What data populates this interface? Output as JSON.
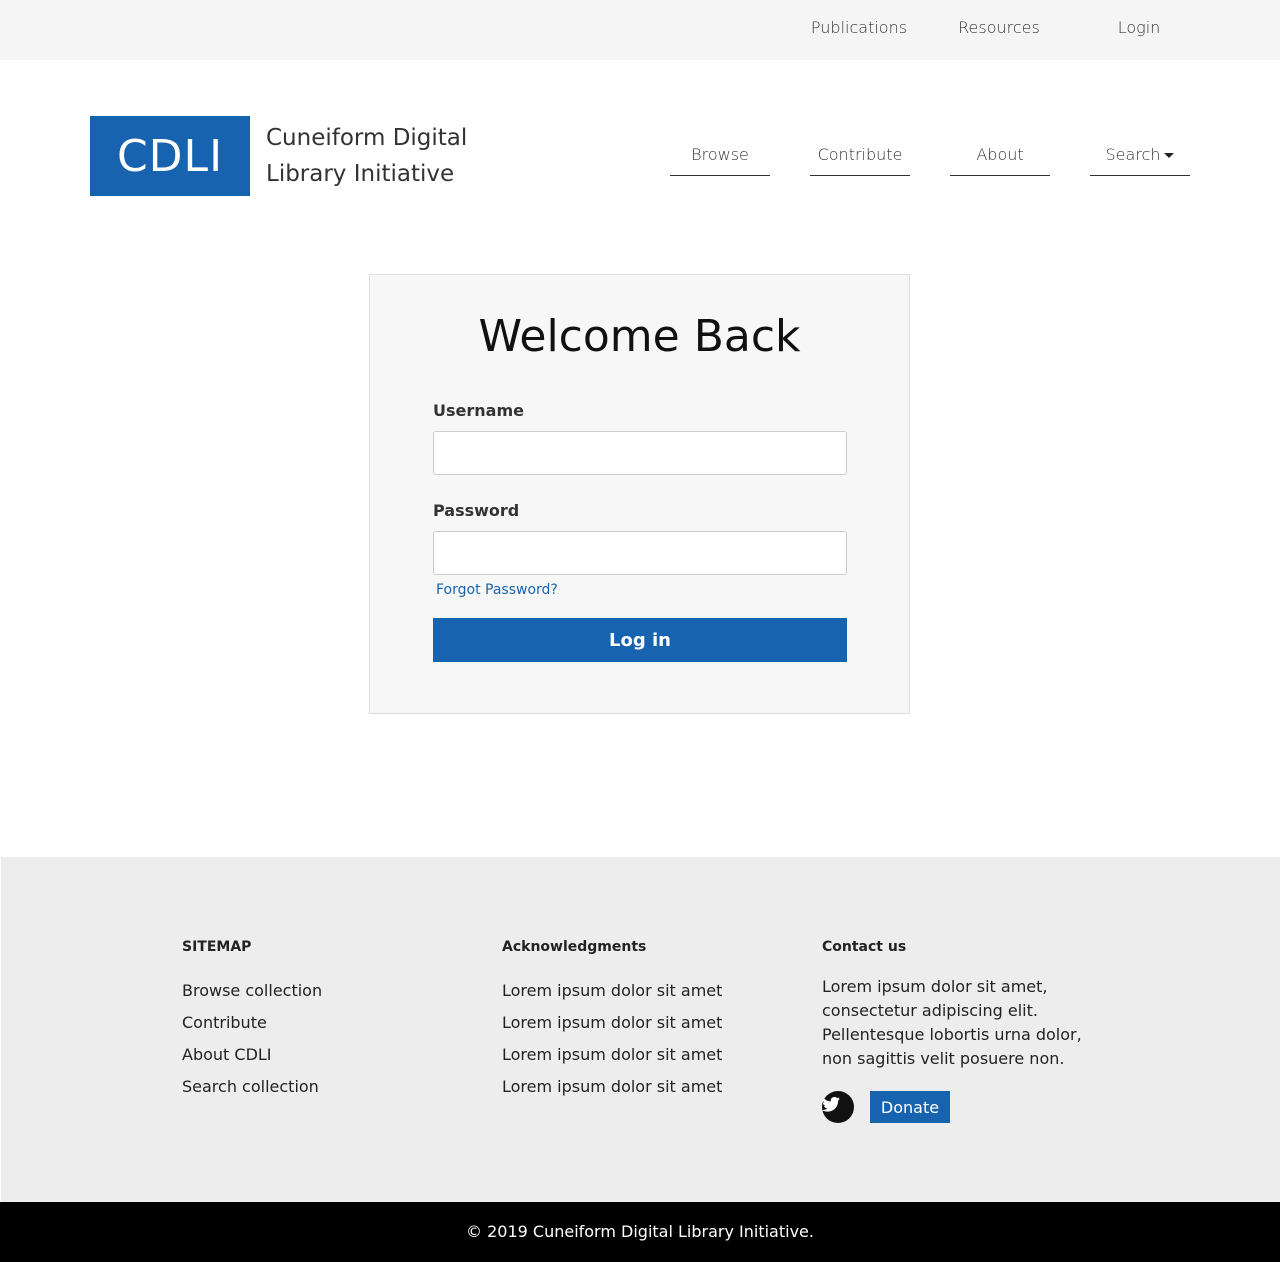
{
  "topnav": {
    "publications": "Publications",
    "resources": "Resources",
    "login": "Login"
  },
  "logo": {
    "abbr": "CDLI",
    "title_line1": "Cuneiform Digital",
    "title_line2": "Library Initiative"
  },
  "mainnav": {
    "browse": "Browse",
    "contribute": "Contribute",
    "about": "About",
    "search": "Search"
  },
  "login_form": {
    "heading": "Welcome Back",
    "username_label": "Username",
    "username_value": "",
    "password_label": "Password",
    "password_value": "",
    "forgot": "Forgot Password?",
    "submit": "Log in"
  },
  "footer": {
    "sitemap": {
      "heading": "SITEMAP",
      "links": [
        "Browse collection",
        "Contribute",
        "About CDLI",
        "Search collection"
      ]
    },
    "acknowledgments": {
      "heading": "Acknowledgments",
      "items": [
        "Lorem ipsum dolor sit amet",
        "Lorem ipsum dolor sit amet",
        "Lorem ipsum dolor sit amet",
        "Lorem ipsum dolor sit amet"
      ]
    },
    "contact": {
      "heading": "Contact us",
      "text": "Lorem ipsum dolor sit amet, consectetur adipiscing elit. Pellentesque lobortis urna dolor, non sagittis velit posuere non.",
      "donate": "Donate",
      "social_icon": "twitter-icon"
    },
    "copyright": "© 2019 Cuneiform Digital Library Initiative."
  },
  "colors": {
    "brand": "#1763af",
    "footer_bg": "#ededed",
    "topbar_bg": "#f5f5f5"
  }
}
